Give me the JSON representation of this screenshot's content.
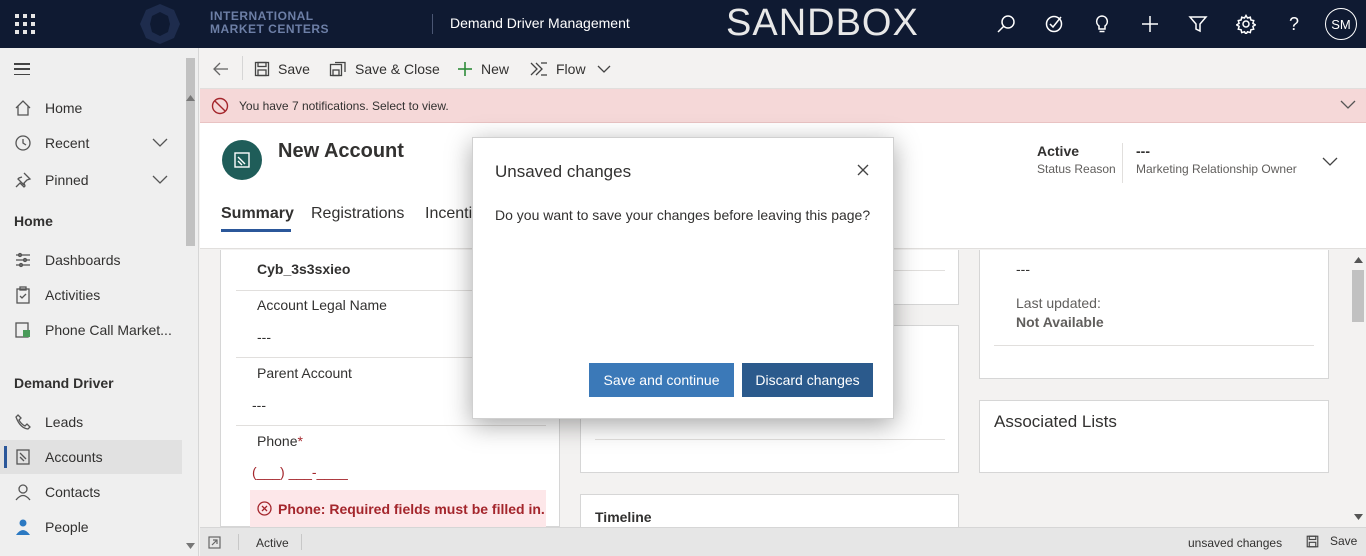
{
  "topbar": {
    "logo_line1": "INTERNATIONAL",
    "logo_line2": "MARKET CENTERS",
    "app_title": "Demand Driver Management",
    "environment": "SANDBOX",
    "avatar_initials": "SM",
    "icons": [
      "search-icon",
      "assistant-icon",
      "lightbulb-icon",
      "plus-icon",
      "filter-icon",
      "gear-icon",
      "help-icon"
    ]
  },
  "sidebar": {
    "items_top": [
      {
        "label": "Home",
        "icon": "home-icon"
      },
      {
        "label": "Recent",
        "icon": "clock-icon"
      },
      {
        "label": "Pinned",
        "icon": "pin-icon"
      }
    ],
    "section_home": "Home",
    "items_home": [
      {
        "label": "Dashboards",
        "icon": "dashboard-icon"
      },
      {
        "label": "Activities",
        "icon": "clipboard-icon"
      },
      {
        "label": "Phone Call Market...",
        "icon": "phone-sheet-icon"
      }
    ],
    "section_dd": "Demand Driver",
    "items_dd": [
      {
        "label": "Leads",
        "icon": "phone-icon"
      },
      {
        "label": "Accounts",
        "icon": "building-icon"
      },
      {
        "label": "Contacts",
        "icon": "person-icon"
      },
      {
        "label": "People",
        "icon": "people-icon"
      }
    ]
  },
  "commandbar": {
    "save": "Save",
    "save_close": "Save & Close",
    "new": "New",
    "flow": "Flow"
  },
  "notification": {
    "text": "You have 7 notifications. Select to view."
  },
  "record": {
    "title": "New Account",
    "status_value": "Active",
    "status_label": "Status Reason",
    "owner_value": "---",
    "owner_label": "Marketing Relationship Owner"
  },
  "tabs": [
    "Summary",
    "Registrations",
    "Incenti"
  ],
  "form": {
    "account_name_value": "Cyb_3s3sxieo",
    "legal_name_label": "Account Legal Name",
    "legal_name_value": "---",
    "parent_label": "Parent Account",
    "parent_value": "---",
    "phone_label": "Phone",
    "phone_required": "*",
    "phone_mask": "(___) ___-____",
    "phone_error": "Phone: Required fields must be filled in.",
    "right_value": "---",
    "last_updated_label": "Last updated:",
    "last_updated_value": "Not Available",
    "associated_lists": "Associated Lists",
    "timeline": "Timeline"
  },
  "statusbar": {
    "status": "Active",
    "unsaved": "unsaved changes",
    "save": "Save"
  },
  "dialog": {
    "title": "Unsaved changes",
    "message": "Do you want to save your changes before leaving this page?",
    "save_button": "Save and continue",
    "discard_button": "Discard changes"
  },
  "colors": {
    "topbar": "#0f1a32",
    "primary_button": "#3b79b8",
    "secondary_button": "#2b5a8c",
    "error": "#a4262c",
    "notification_bg": "#f5d8d8"
  }
}
